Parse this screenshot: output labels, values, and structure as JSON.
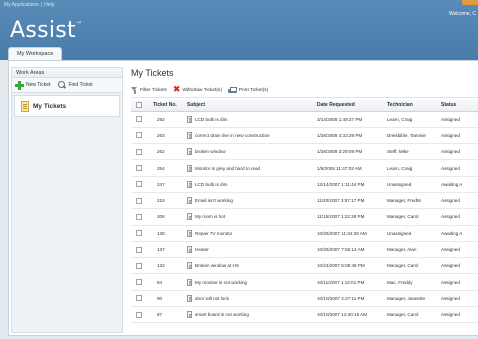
{
  "header": {
    "links": [
      "My Applications",
      "Help"
    ],
    "link_separator": "|",
    "welcome": "Welcome, C",
    "app_name": "Assist",
    "trademark": "™"
  },
  "workspace_tab": "My Workspace",
  "sidebar": {
    "title": "Work Areas",
    "new_ticket": "New Ticket",
    "find_ticket": "Find Ticket",
    "item": "My Tickets"
  },
  "main": {
    "title": "My Tickets",
    "toolbar": {
      "filter": "Filter Tickets",
      "withdraw": "Withdraw Ticket(s)",
      "print": "Print Ticket(s)"
    },
    "columns": [
      "",
      "Ticket No.",
      "Subject",
      "Date Requested",
      "Technician",
      "Status"
    ],
    "rows": [
      {
        "no": "292",
        "subject": "LCD bulb is dim",
        "date": "3/14/2008 1:49:37 PM",
        "tech": "Learn, Craig",
        "status": "Assigned"
      },
      {
        "no": "263",
        "subject": "correct drain line in new construction",
        "date": "1/28/2008 4:33:39 PM",
        "tech": "Dreisbible, Tammie",
        "status": "Assigned"
      },
      {
        "no": "262",
        "subject": "broken window",
        "date": "1/28/2008 3:29:09 PM",
        "tech": "Steff, Mike",
        "status": "Assigned"
      },
      {
        "no": "254",
        "subject": "Monitor is grey and hard to read",
        "date": "1/8/2008 11:47:03 AM",
        "tech": "Learn, Craig",
        "status": "Assigned"
      },
      {
        "no": "247",
        "subject": "LCD bulb is dim",
        "date": "12/14/2007 1:11:44 PM",
        "tech": "Unassigned",
        "status": "Awaiting A"
      },
      {
        "no": "218",
        "subject": "Email isn't working",
        "date": "11/20/2007 3:57:17 PM",
        "tech": "Manager, FredM",
        "status": "Assigned"
      },
      {
        "no": "206",
        "subject": "My room is hot",
        "date": "11/15/2007 1:22:38 PM",
        "tech": "Manager, Carol",
        "status": "Assigned"
      },
      {
        "no": "138",
        "subject": "Repair TV monitor",
        "date": "10/26/2007 11:34:26 AM",
        "tech": "Unassigned",
        "status": "Awaiting A"
      },
      {
        "no": "137",
        "subject": "Heater",
        "date": "10/26/2007 7:55:14 AM",
        "tech": "Manager, Alan",
        "status": "Assigned"
      },
      {
        "no": "132",
        "subject": "Broken window at HS",
        "date": "10/24/2007 5:09:48 PM",
        "tech": "Manager, Carol",
        "status": "Assigned"
      },
      {
        "no": "94",
        "subject": "My monitor is not working",
        "date": "10/11/2007 1:12:01 PM",
        "tech": "Mac, Freddy",
        "status": "Assigned"
      },
      {
        "no": "90",
        "subject": "door will not lock",
        "date": "10/10/2007 2:27:11 PM",
        "tech": "Manager, Jeanette",
        "status": "Assigned"
      },
      {
        "no": "87",
        "subject": "smart board is not working",
        "date": "10/10/2007 12:40:15 AM",
        "tech": "Manager, Carol",
        "status": "Assigned"
      }
    ]
  },
  "colors": {
    "header_blue": "#4f82b0",
    "accent_orange": "#e39a3c",
    "panel_bg": "#e3eaef"
  }
}
